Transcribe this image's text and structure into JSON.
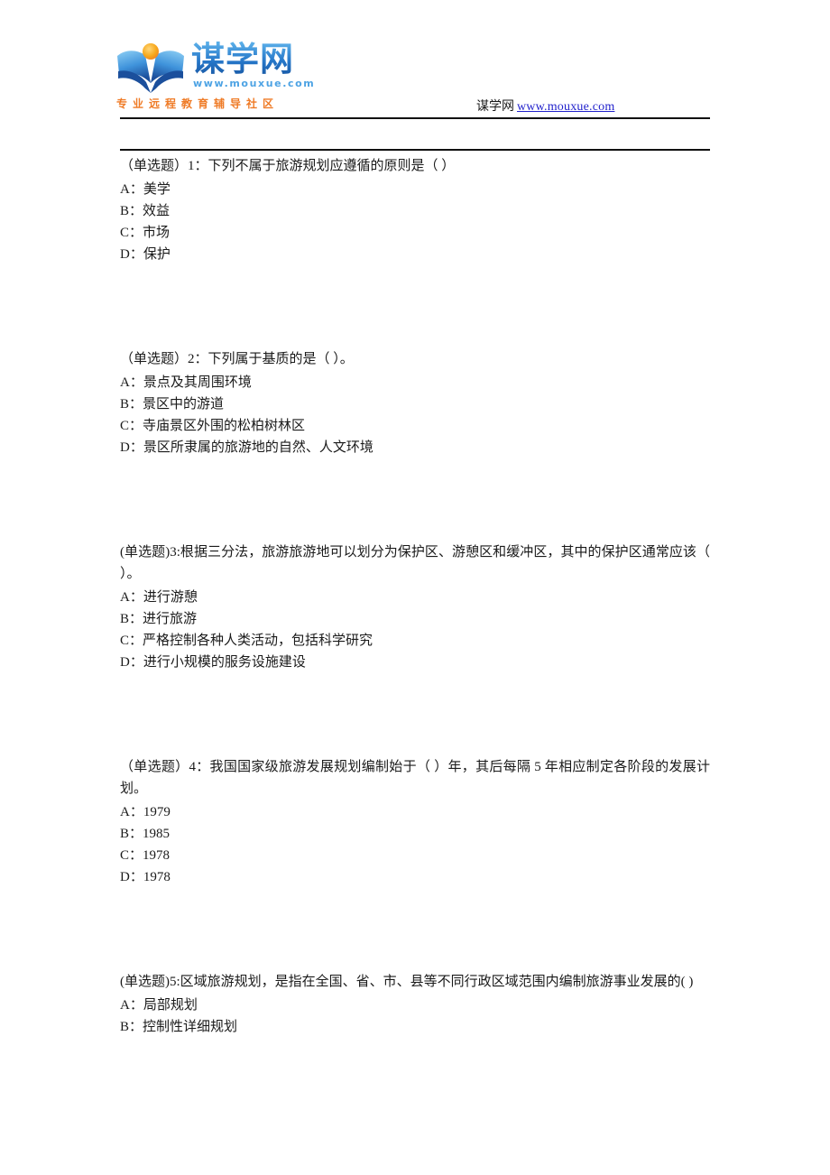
{
  "header": {
    "logo": {
      "brand_cn": "谋学网",
      "url_small": "www.mouxue.com",
      "tagline": "专业远程教育辅导社区",
      "mark_colors": {
        "book_blue_light": "#63b8ee",
        "book_blue_dark": "#17539e",
        "sun_orange": "#f5a623"
      }
    },
    "site_name": "谋学网",
    "site_url": "www.mouxue.com",
    "link_color": "#2222cc"
  },
  "questions": [
    {
      "stem": "（单选题）1：下列不属于旅游规划应遵循的原则是（  ）",
      "options": [
        "A：美学",
        "B：效益",
        "C：市场",
        "D：保护"
      ]
    },
    {
      "stem": "（单选题）2：下列属于基质的是（  ）。",
      "options": [
        "A：景点及其周围环境",
        "B：景区中的游道",
        "C：寺庙景区外围的松柏树林区",
        "D：景区所隶属的旅游地的自然、人文环境"
      ]
    },
    {
      "stem": "(单选题)3:根据三分法，旅游旅游地可以划分为保护区、游憩区和缓冲区，其中的保护区通常应该（  ）。",
      "options": [
        "A：进行游憩",
        "B：进行旅游",
        "C：严格控制各种人类活动，包括科学研究",
        "D：进行小规模的服务设施建设"
      ]
    },
    {
      "stem": "（单选题）4：我国国家级旅游发展规划编制始于（  ）年，其后每隔 5 年相应制定各阶段的发展计划。",
      "options": [
        "A：1979",
        "B：1985",
        "C：1978",
        "D：1978"
      ]
    },
    {
      "stem": "(单选题)5:区域旅游规划，是指在全国、省、市、县等不同行政区域范围内编制旅游事业发展的( )",
      "options": [
        "A：局部规划",
        "B：控制性详细规划"
      ]
    }
  ]
}
